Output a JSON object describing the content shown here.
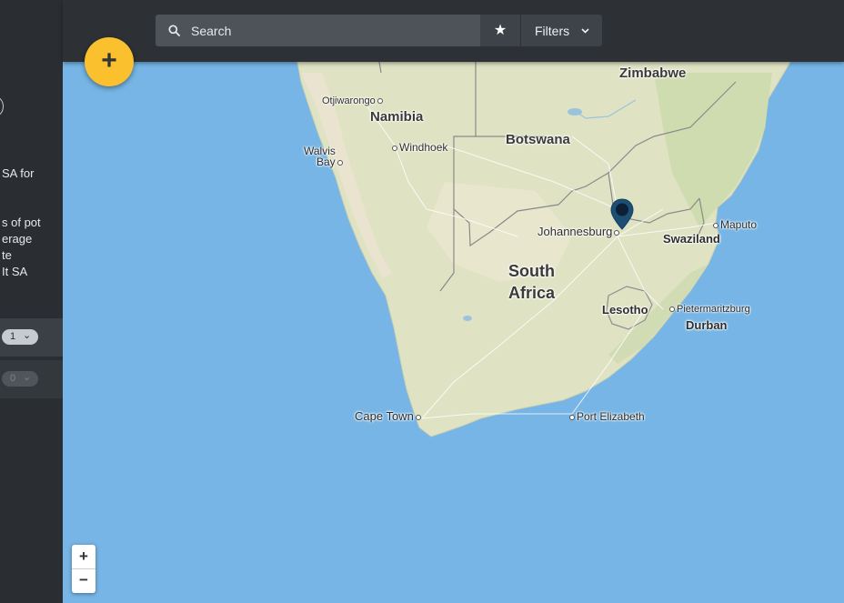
{
  "sidebar": {
    "text_fragments": [
      "SA for",
      "s of pot",
      "erage",
      "te",
      "It SA"
    ],
    "rows": [
      {
        "count": "1",
        "chevron_icon": "chevron-down-icon"
      },
      {
        "count": "0",
        "chevron_icon": "chevron-down-icon"
      }
    ]
  },
  "toolbar": {
    "search_placeholder": "Search",
    "search_icon": "search-icon",
    "favorites_icon": "star-icon",
    "favorites_glyph": "★",
    "filters_label": "Filters",
    "filters_icon": "chevron-down-icon"
  },
  "add_button": {
    "label": "+",
    "icon": "plus-icon",
    "color": "#fbc02d"
  },
  "zoom_controls": {
    "zoom_in": "+",
    "zoom_out": "−"
  },
  "map": {
    "water_color": "#76b5e5",
    "land_color": "#dfe3c4",
    "marker": {
      "icon": "map-pin-icon",
      "location": "Johannesburg",
      "color": "#1d4e73"
    },
    "countries": [
      "Zimbabwe",
      "Namibia",
      "Botswana",
      "South",
      "Africa",
      "Swaziland",
      "Lesotho"
    ],
    "cities": [
      "Otjiwarongo",
      "Walvis",
      "Bay",
      "Windhoek",
      "Johannesburg",
      "Maputo",
      "Pietermaritzburg",
      "Durban",
      "Cape Town",
      "Port Elizabeth"
    ]
  }
}
